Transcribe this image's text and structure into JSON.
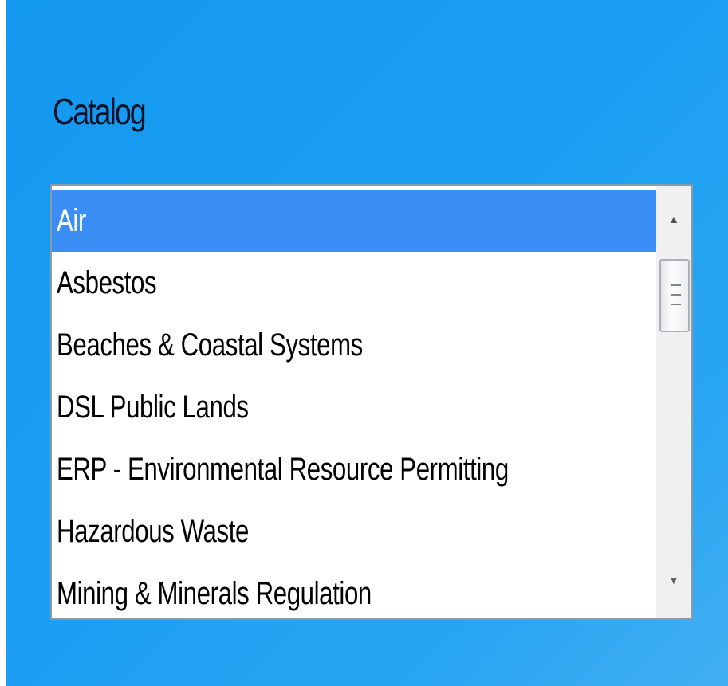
{
  "catalog": {
    "title": "Catalog",
    "items": [
      "Air",
      "Asbestos",
      "Beaches & Coastal Systems",
      "DSL Public Lands",
      "ERP - Environmental Resource Permitting",
      "Hazardous Waste",
      "Mining & Minerals Regulation"
    ],
    "selected_item": "Air"
  },
  "scrollbar": {
    "up_icon": "scroll-up-arrow-icon",
    "down_icon": "scroll-down-arrow-icon"
  },
  "colors": {
    "background": "#1a9ef3",
    "selection": "#3a8ef5",
    "title_text": "#06142a"
  }
}
